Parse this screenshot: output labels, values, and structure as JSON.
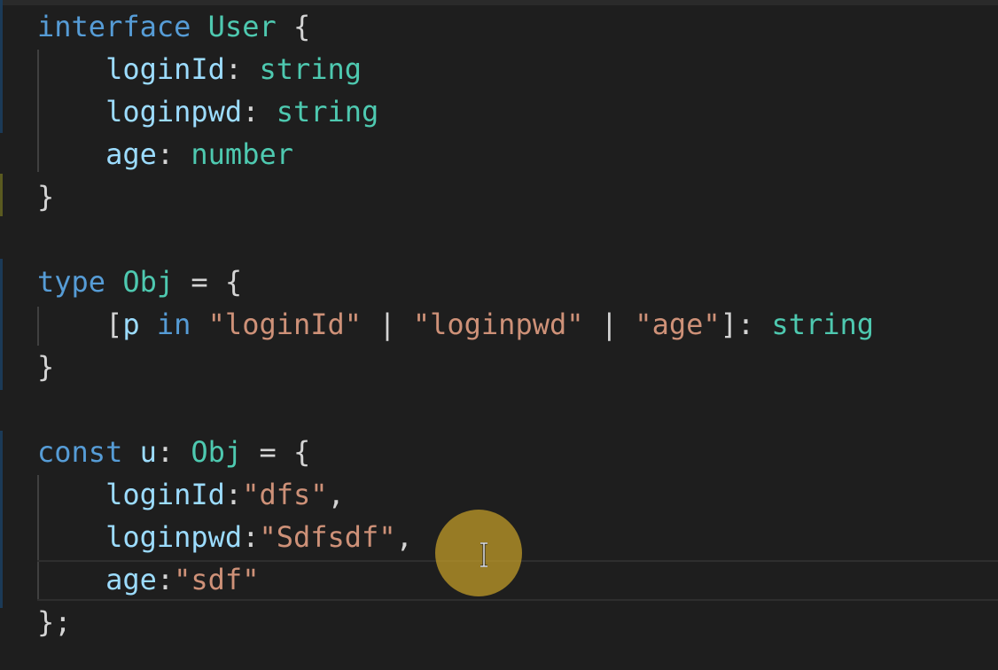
{
  "colors": {
    "background": "#1e1e1e",
    "keyword": "#569cd6",
    "type": "#4ec9b0",
    "property": "#9cdcfe",
    "string": "#ce9178",
    "punctuation": "#d4d4d4",
    "cursor_highlight": "#ba9628"
  },
  "code": {
    "interface_block": {
      "kw": "interface",
      "name": "User",
      "open": "{",
      "fields": [
        {
          "name": "loginId",
          "colon": ":",
          "type": "string"
        },
        {
          "name": "loginpwd",
          "colon": ":",
          "type": "string"
        },
        {
          "name": "age",
          "colon": ":",
          "type": "number"
        }
      ],
      "close": "}"
    },
    "type_block": {
      "kw": "type",
      "name": "Obj",
      "eq": "=",
      "open": "{",
      "mapped": {
        "lbracket": "[",
        "var": "p",
        "in": "in",
        "key1": "\"loginId\"",
        "pipe1": "|",
        "key2": "\"loginpwd\"",
        "pipe2": "|",
        "key3": "\"age\"",
        "rbracket": "]",
        "colon": ":",
        "value_type": "string"
      },
      "close": "}"
    },
    "const_block": {
      "kw": "const",
      "name": "u",
      "colon": ":",
      "type": "Obj",
      "eq": "=",
      "open": "{",
      "entries": [
        {
          "key": "loginId",
          "colon": ":",
          "value": "\"dfs\"",
          "comma": ","
        },
        {
          "key": "loginpwd",
          "colon": ":",
          "value": "\"Sdfsdf\"",
          "comma": ","
        },
        {
          "key": "age",
          "colon": ":",
          "value": "\"sdf\"",
          "comma": ""
        }
      ],
      "close": "};"
    }
  },
  "cursor": {
    "icon": "i-beam-cursor-icon"
  }
}
